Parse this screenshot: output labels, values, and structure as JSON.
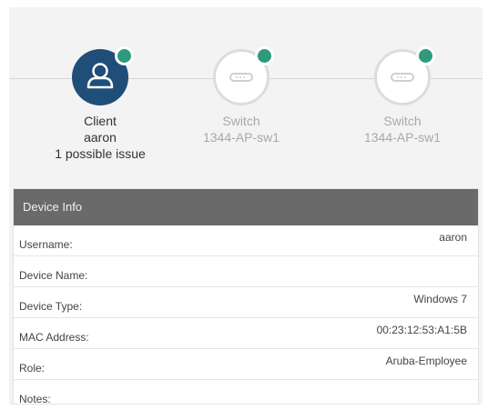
{
  "topology": {
    "client": {
      "icon": "user-icon",
      "status_color": "#2e9a7d",
      "line1": "Client",
      "line2": "aaron",
      "line3": "1 possible issue"
    },
    "switches": [
      {
        "icon": "switch-icon",
        "status_color": "#2e9a7d",
        "line1": "Switch",
        "line2": "1344-AP-sw1"
      },
      {
        "icon": "switch-icon",
        "status_color": "#2e9a7d",
        "line1": "Switch",
        "line2": "1344-AP-sw1"
      }
    ]
  },
  "device_info": {
    "title": "Device Info",
    "rows": [
      {
        "key": "Username:",
        "value": "aaron"
      },
      {
        "key": "Device Name:",
        "value": ""
      },
      {
        "key": "Device Type:",
        "value": "Windows 7"
      },
      {
        "key": "MAC Address:",
        "value": "00:23:12:53:A1:5B"
      },
      {
        "key": "Role:",
        "value": "Aruba-Employee"
      },
      {
        "key": "Notes:",
        "value": ""
      }
    ]
  },
  "colors": {
    "client_fill": "#1f4e79",
    "header_bg": "#6a6a6a",
    "status_ok": "#2e9a7d"
  }
}
